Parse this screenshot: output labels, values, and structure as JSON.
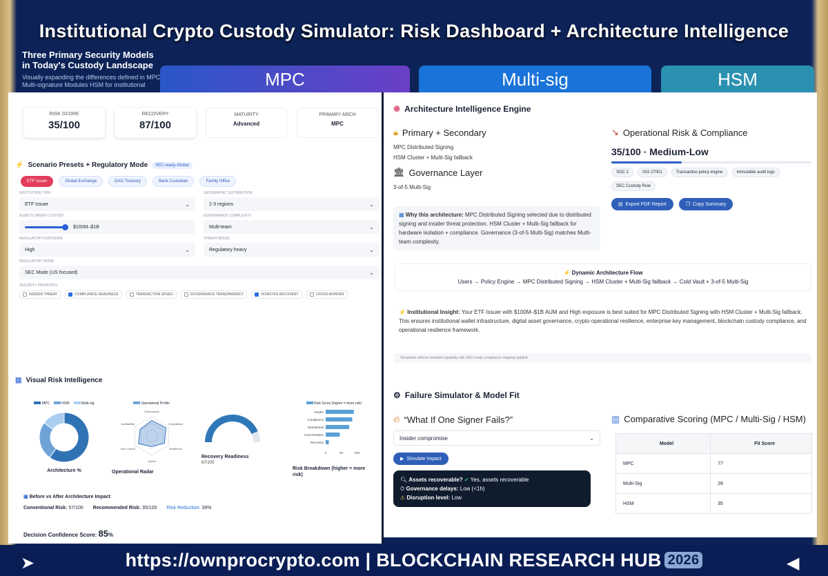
{
  "banner": {
    "title": "Institutional Crypto Custody Simulator: Risk Dashboard + Architecture Intelligence",
    "intro_heading": "Three Primary Security Models in Today's Custody Landscape",
    "intro_text": "Visually expanding the differences defined in MPC, Multi-signature Modules HSM for institutional crypto custody",
    "models": [
      "MPC",
      "Multi-sig",
      "HSM"
    ]
  },
  "stats": [
    {
      "label": "RISK SCORE",
      "value": "35/100"
    },
    {
      "label": "RECOVERY",
      "value": "87/100"
    },
    {
      "label": "MATURITY",
      "value": "Advanced"
    },
    {
      "label": "PRIMARY ARCH",
      "value": "MPC"
    }
  ],
  "scenario": {
    "title": "Scenario Presets + Regulatory Mode",
    "badge": "SEC-ready-Global",
    "presets": [
      "ETF Issuer",
      "Global Exchange",
      "DAO Treasury",
      "Bank Custodian",
      "Family Office"
    ],
    "fields": [
      {
        "label": "INSTITUTION TYPE",
        "value": "ETF Issuer"
      },
      {
        "label": "GEOGRAPHIC DISTRIBUTION",
        "value": "2-3 regions"
      },
      {
        "label": "ASSETS UNDER CUSTODY",
        "value": "$100M–$1B"
      },
      {
        "label": "GOVERNANCE COMPLEXITY",
        "value": "Multi-team"
      },
      {
        "label": "REGULATORY EXPOSURE",
        "value": "High"
      },
      {
        "label": "THREAT MODEL",
        "value": "Regulatory heavy"
      }
    ],
    "reg_mode_label": "REGULATORY MODE",
    "reg_mode": "SEC Mode (US focused)",
    "priorities_label": "SECURITY PRIORITIES",
    "priorities": [
      {
        "label": "INSIDER THREAT",
        "checked": false
      },
      {
        "label": "COMPLIANCE READINESS",
        "checked": true
      },
      {
        "label": "TRANSACTION SPEED",
        "checked": false
      },
      {
        "label": "GOVERNANCE TRANSPARENCY",
        "checked": false
      },
      {
        "label": "DISASTER RECOVERY",
        "checked": true
      },
      {
        "label": "CROSS-BORDER",
        "checked": false
      }
    ]
  },
  "visual": {
    "title": "Visual Risk Intelligence",
    "donut_legend": [
      "MPC",
      "HSM",
      "Multi-sig"
    ],
    "donut_caption": "Architecture %",
    "radar_legend": "Operational Profile",
    "radar_axes": [
      "Governance",
      "Compliance",
      "Resilience",
      "Speed",
      "Key Control",
      "Auditability"
    ],
    "radar_caption": "Operational Radar",
    "gauge_caption": "Recovery Readiness",
    "gauge_value": "87/100",
    "breakdown_legend": "Risk Score (higher = more risk)",
    "breakdown_labels": [
      "Insider",
      "Compliance",
      "Operational",
      "Concentration",
      "Recovery"
    ],
    "breakdown_ticks": [
      "0",
      "50",
      "100"
    ],
    "breakdown_caption": "Risk Breakdown (higher = more risk)"
  },
  "impact": {
    "title": "Before vs After Architecture Impact",
    "conventional_label": "Conventional Risk:",
    "conventional": "57/100",
    "recommended_label": "Recommended Risk:",
    "recommended": "35/100",
    "reduction_label": "Risk Reduction:",
    "reduction": "39%",
    "confidence_label": "Decision Confidence Score:",
    "confidence": "85",
    "confidence_unit": "%"
  },
  "arch": {
    "title": "Architecture Intelligence Engine",
    "primary_title": "Primary + Secondary",
    "primary": "MPC Distributed Signing",
    "secondary": "HSM Cluster + Multi-Sig fallback",
    "governance_title": "Governance Layer",
    "governance": "3-of-5 Multi-Sig",
    "why_label": "Why this architecture:",
    "why_text": "MPC Distributed Signing selected due to distributed signing and insider threat protection. HSM Cluster + Multi-Sig fallback for hardware isolation + compliance. Governance (3-of-5 Multi-Sig) matches Multi-team complexity.",
    "ops_title": "Operational Risk & Compliance",
    "ops_score": "35/100 · Medium-Low",
    "ops_progress": 0.35,
    "tags": [
      "SOC 2",
      "ISO 27001",
      "Transaction policy engine",
      "Immutable audit logs",
      "SEC Custody Rule"
    ],
    "export_btn": "Export PDF Report",
    "copy_btn": "Copy Summary",
    "flow_title": "Dynamic Architecture Flow",
    "flow": "Users → Policy Engine → MPC Distributed Signing → HSM Cluster + Multi-Sig fallback → Cold Vault + 3-of-5 Multi-Sig",
    "insight_label": "Institutional Insight:",
    "insight": "Your ETF Issuer with $100M–$1B AUM and High exposure is best suited for MPC Distributed Signing with HSM Cluster + Multi-Sig fallback. This ensures institutional wallet infrastructure, digital asset governance, crypto operational resilience, enterprise key management, blockchain custody compliance, and operational resilience framework.",
    "footnote": "Simulation reflects modeled capability with SEC-ready compliance mapping applied."
  },
  "failure": {
    "title": "Failure Simulator & Model Fit",
    "question": "“What If One Signer Fails?”",
    "scenario": "Insider compromise",
    "simulate_btn": "Simulate Impact",
    "results": [
      {
        "label": "Assets recoverable?",
        "value": "Yes, assets recoverable"
      },
      {
        "label": "Governance delays:",
        "value": "Low (<1h)"
      },
      {
        "label": "Disruption level:",
        "value": "Low"
      }
    ],
    "compare_title": "Comparative Scoring (MPC / Multi-Sig / HSM)",
    "table_headers": [
      "Model",
      "Fit Score"
    ],
    "table_rows": [
      [
        "MPC",
        "77"
      ],
      [
        "Multi-Sig",
        "28"
      ],
      [
        "HSM",
        "35"
      ]
    ]
  },
  "footer": {
    "text": "https://ownprocrypto.com | BLOCKCHAIN RESEARCH HUB",
    "year": "2026"
  },
  "chart_data": [
    {
      "type": "pie",
      "title": "",
      "categories": [
        "MPC",
        "HSM",
        "Multi-sig"
      ],
      "values": [
        60,
        25,
        15
      ]
    },
    {
      "type": "bar",
      "title": "",
      "categories": [
        "Insider",
        "Compliance",
        "Operational",
        "Concentration",
        "Recovery"
      ],
      "values": [
        90,
        85,
        75,
        45,
        10
      ],
      "xlim": [
        0,
        150
      ]
    }
  ]
}
